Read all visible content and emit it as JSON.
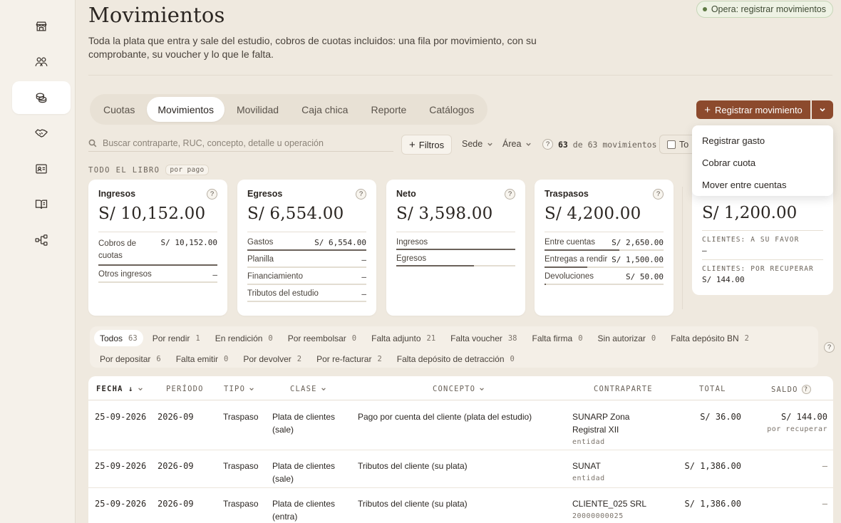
{
  "sidebar": {
    "items": [
      {
        "icon": "store-icon"
      },
      {
        "icon": "users-icon"
      },
      {
        "icon": "coins-icon",
        "active": true
      },
      {
        "icon": "handshake-icon"
      },
      {
        "icon": "id-card-icon"
      },
      {
        "icon": "book-icon"
      },
      {
        "icon": "workflow-icon"
      }
    ]
  },
  "header": {
    "title": "Movimientos",
    "description": "Toda la plata que entra y sale del estudio, cobros de cuotas incluidos: una fila por movimiento, con su comprobante, su voucher y lo que le falta.",
    "status": "Opera: registrar movimientos",
    "status_color": "#5f7a44"
  },
  "tabs": [
    {
      "label": "Cuotas"
    },
    {
      "label": "Movimientos",
      "active": true
    },
    {
      "label": "Movilidad"
    },
    {
      "label": "Caja chica"
    },
    {
      "label": "Reporte"
    },
    {
      "label": "Catálogos"
    }
  ],
  "actions": {
    "register_label": "Registrar movimiento",
    "accent": "#8c4a2d",
    "menu": [
      "Registrar gasto",
      "Cobrar cuota",
      "Mover entre cuentas"
    ]
  },
  "toolbar": {
    "search_placeholder": "Buscar contraparte, RUC, concepto, detalle u operación",
    "filters_label": "Filtros",
    "sede_label": "Sede",
    "area_label": "Área",
    "help": "?",
    "count_shown": "63",
    "count_of": "de",
    "count_total": "63 movimientos",
    "checkbox_label": "To"
  },
  "section": {
    "label": "TODO EL LIBRO",
    "badge": "por pago"
  },
  "cards": [
    {
      "title": "Ingresos",
      "amount": "S/ 10,152.00",
      "rows": [
        {
          "label": "Cobros de cuotas",
          "value": "S/ 10,152.00",
          "fill": 1.0
        },
        {
          "label": "Otros ingresos",
          "value": "—",
          "fill": 0
        }
      ]
    },
    {
      "title": "Egresos",
      "amount": "S/ 6,554.00",
      "rows": [
        {
          "label": "Gastos",
          "value": "S/ 6,554.00",
          "fill": 1.0
        },
        {
          "label": "Planilla",
          "value": "—",
          "fill": 0
        },
        {
          "label": "Financiamiento",
          "value": "—",
          "fill": 0
        },
        {
          "label": "Tributos del estudio",
          "value": "—",
          "fill": 0
        }
      ]
    },
    {
      "title": "Neto",
      "amount": "S/ 3,598.00",
      "rows": [
        {
          "label": "Ingresos",
          "value": "",
          "fill": 1.0
        },
        {
          "label": "Egresos",
          "value": "",
          "fill": 0.65
        }
      ]
    },
    {
      "title": "Traspasos",
      "amount": "S/ 4,200.00",
      "rows": [
        {
          "label": "Entre cuentas",
          "value": "S/ 2,650.00",
          "fill": 0.63
        },
        {
          "label": "Entregas a rendir",
          "value": "S/ 1,500.00",
          "fill": 0.36
        },
        {
          "label": "Devoluciones",
          "value": "S/ 50.00",
          "fill": 0.012
        }
      ]
    }
  ],
  "clients_card": {
    "amount": "S/ 1,200.00",
    "favor_label": "CLIENTES: A SU FAVOR",
    "favor_value": "—",
    "recover_label": "CLIENTES: POR RECUPERAR",
    "recover_value": "S/ 144.00"
  },
  "chips": [
    [
      {
        "label": "Todos",
        "n": "63",
        "active": true
      },
      {
        "label": "Por rendir",
        "n": "1"
      },
      {
        "label": "En rendición",
        "n": "0"
      },
      {
        "label": "Por reembolsar",
        "n": "0"
      },
      {
        "label": "Falta adjunto",
        "n": "21"
      },
      {
        "label": "Falta voucher",
        "n": "38"
      },
      {
        "label": "Falta firma",
        "n": "0"
      },
      {
        "label": "Sin autorizar",
        "n": "0"
      },
      {
        "label": "Falta depósito BN",
        "n": "2"
      }
    ],
    [
      {
        "label": "Por depositar",
        "n": "6"
      },
      {
        "label": "Falta emitir",
        "n": "0"
      },
      {
        "label": "Por devolver",
        "n": "2"
      },
      {
        "label": "Por re-facturar",
        "n": "2"
      },
      {
        "label": "Falta depósito de detracción",
        "n": "0"
      }
    ]
  ],
  "table": {
    "headers": {
      "fecha": "FECHA ↓",
      "periodo": "PERÍODO",
      "tipo": "TIPO",
      "clase": "CLASE",
      "concepto": "CONCEPTO",
      "contraparte": "CONTRAPARTE",
      "total": "TOTAL",
      "saldo": "SALDO"
    },
    "rows": [
      {
        "fecha": "25-09-2026",
        "periodo": "2026-09",
        "tipo": "Traspaso",
        "clase": "Plata de clientes (sale)",
        "concepto": "Pago por cuenta del cliente (plata del estudio)",
        "contraparte": "SUNARP Zona Registral XII",
        "contraparte_sub": "entidad",
        "total": "S/ 36.00",
        "saldo": "S/ 144.00",
        "saldo_sub": "por recuperar"
      },
      {
        "fecha": "25-09-2026",
        "periodo": "2026-09",
        "tipo": "Traspaso",
        "clase": "Plata de clientes (sale)",
        "concepto": "Tributos del cliente (su plata)",
        "contraparte": "SUNAT",
        "contraparte_sub": "entidad",
        "total": "S/ 1,386.00",
        "saldo": "—",
        "saldo_sub": ""
      },
      {
        "fecha": "25-09-2026",
        "periodo": "2026-09",
        "tipo": "Traspaso",
        "clase": "Plata de clientes (entra)",
        "concepto": "Tributos del cliente (su plata)",
        "contraparte": "CLIENTE_025 SRL",
        "contraparte_sub": "20000000025",
        "total": "S/ 1,386.00",
        "saldo": "—",
        "saldo_sub": ""
      }
    ]
  }
}
